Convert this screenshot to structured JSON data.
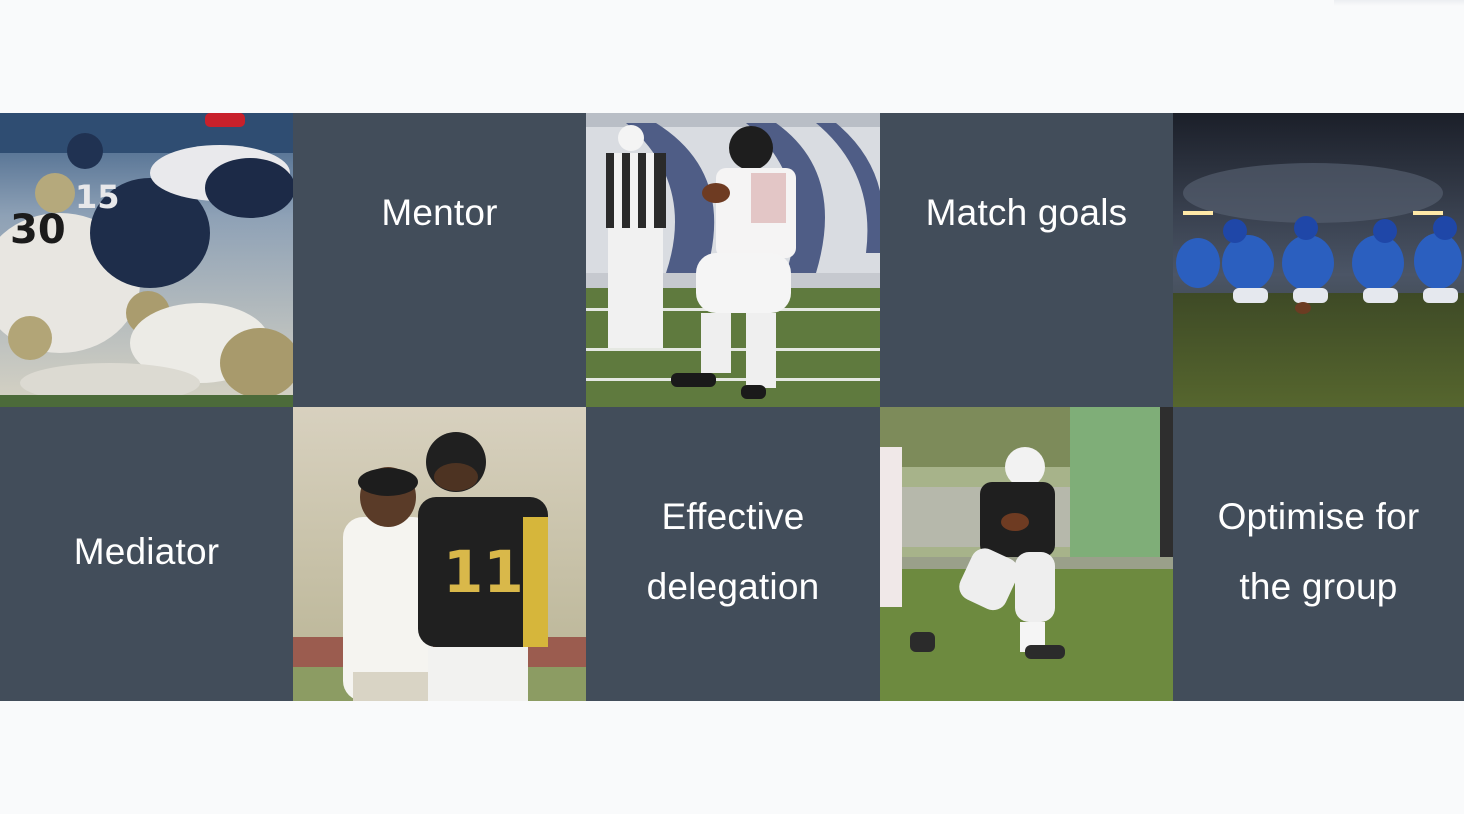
{
  "tiles": {
    "mentor": "Mentor",
    "match_goals": "Match goals",
    "mediator": "Mediator",
    "effective_delegation": "Effective delegation",
    "optimise_group": "Optimise for the group"
  },
  "photos": [
    "football-pileup-photo",
    "quarterback-referee-photo",
    "lineup-night-photo",
    "coach-player-photo",
    "youth-runner-photo"
  ],
  "colors": {
    "tile_bg": "#424d5a",
    "page_bg": "#f9fafb",
    "text": "#ffffff"
  }
}
